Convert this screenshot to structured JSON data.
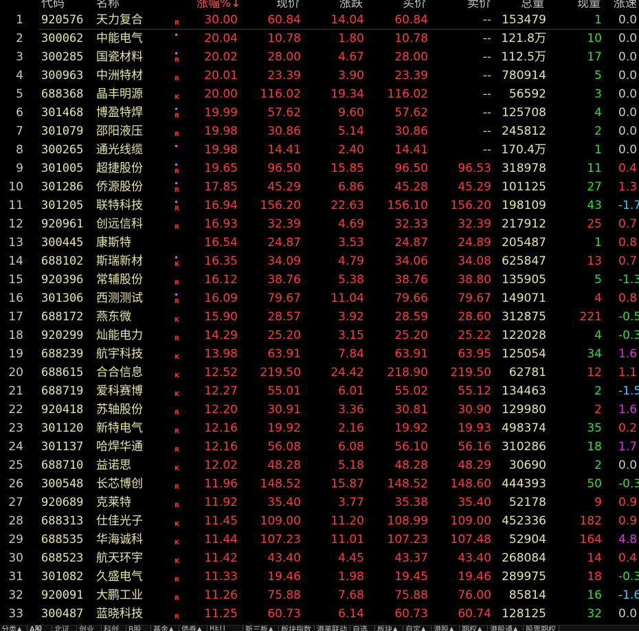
{
  "header": {
    "code": "代码",
    "name": "名称",
    "pct": "涨幅%",
    "sort_arrow": "↓",
    "price": "现价",
    "chg": "涨跌",
    "buy": "买价",
    "sell": "卖价",
    "vol": "总量",
    "cur": "现量",
    "speed": "涨速"
  },
  "colors": {
    "up": "#ff3a3a",
    "down": "#33ccff",
    "green": "#33dd33",
    "purple": "#dd33dd",
    "yellow": "#e6e6a0"
  },
  "rows": [
    {
      "idx": "1",
      "code": "920576",
      "name": "天力复合",
      "dot": false,
      "flag": "R",
      "pct": "30.00",
      "price": "60.84",
      "chg": "14.04",
      "buy": "60.84",
      "sell": "--",
      "vol": "153479",
      "cur": "1",
      "cur_color": "green",
      "speed": "0.0",
      "speed_color": "white"
    },
    {
      "idx": "2",
      "code": "300062",
      "name": "中能电气",
      "dot": true,
      "flag": "",
      "pct": "20.04",
      "price": "10.78",
      "chg": "1.80",
      "buy": "10.78",
      "sell": "--",
      "vol": "121.8万",
      "cur": "10",
      "cur_color": "green",
      "speed": "0.0",
      "speed_color": "white"
    },
    {
      "idx": "3",
      "code": "300285",
      "name": "国瓷材料",
      "dot": true,
      "flag": "R",
      "pct": "20.02",
      "price": "28.00",
      "chg": "4.67",
      "buy": "28.00",
      "sell": "--",
      "vol": "112.5万",
      "cur": "17",
      "cur_color": "green",
      "speed": "0.0",
      "speed_color": "white"
    },
    {
      "idx": "4",
      "code": "300963",
      "name": "中洲特材",
      "dot": false,
      "flag": "R",
      "pct": "20.01",
      "price": "23.39",
      "chg": "3.90",
      "buy": "23.39",
      "sell": "--",
      "vol": "780914",
      "cur": "5",
      "cur_color": "green",
      "speed": "0.0",
      "speed_color": "white"
    },
    {
      "idx": "5",
      "code": "688368",
      "name": "晶丰明源",
      "dot": false,
      "flag": "K",
      "pct": "20.00",
      "price": "116.02",
      "chg": "19.34",
      "buy": "116.02",
      "sell": "--",
      "vol": "56592",
      "cur": "3",
      "cur_color": "green",
      "speed": "0.0",
      "speed_color": "white"
    },
    {
      "idx": "6",
      "code": "301468",
      "name": "博盈特焊",
      "dot": true,
      "flag": "R",
      "pct": "19.99",
      "price": "57.62",
      "chg": "9.60",
      "buy": "57.62",
      "sell": "--",
      "vol": "125708",
      "cur": "4",
      "cur_color": "green",
      "speed": "0.0",
      "speed_color": "white"
    },
    {
      "idx": "7",
      "code": "301079",
      "name": "邵阳液压",
      "dot": false,
      "flag": "R",
      "pct": "19.98",
      "price": "30.86",
      "chg": "5.14",
      "buy": "30.86",
      "sell": "--",
      "vol": "245812",
      "cur": "2",
      "cur_color": "green",
      "speed": "0.0",
      "speed_color": "white"
    },
    {
      "idx": "8",
      "code": "300265",
      "name": "通光线缆",
      "dot": true,
      "flag": "",
      "pct": "19.98",
      "price": "14.41",
      "chg": "2.40",
      "buy": "14.41",
      "sell": "--",
      "vol": "170.4万",
      "cur": "1",
      "cur_color": "green",
      "speed": "0.0",
      "speed_color": "white"
    },
    {
      "idx": "9",
      "code": "301005",
      "name": "超捷股份",
      "dot": true,
      "flag": "R",
      "pct": "19.65",
      "price": "96.50",
      "chg": "15.85",
      "buy": "96.50",
      "sell": "96.53",
      "vol": "318978",
      "cur": "11",
      "cur_color": "green",
      "speed": "0.4",
      "speed_color": "up"
    },
    {
      "idx": "10",
      "code": "301286",
      "name": "侨源股份",
      "dot": true,
      "flag": "R",
      "pct": "17.85",
      "price": "45.29",
      "chg": "6.86",
      "buy": "45.28",
      "sell": "45.29",
      "vol": "101125",
      "cur": "27",
      "cur_color": "green",
      "speed": "1.3",
      "speed_color": "up"
    },
    {
      "idx": "11",
      "code": "301205",
      "name": "联特科技",
      "dot": true,
      "flag": "R",
      "pct": "16.94",
      "price": "156.20",
      "chg": "22.63",
      "buy": "156.10",
      "sell": "156.20",
      "vol": "198109",
      "cur": "43",
      "cur_color": "green",
      "speed": "-1.7",
      "speed_color": "down"
    },
    {
      "idx": "12",
      "code": "920961",
      "name": "创远信科",
      "dot": false,
      "flag": "R",
      "pct": "16.93",
      "price": "32.39",
      "chg": "4.69",
      "buy": "32.33",
      "sell": "32.39",
      "vol": "217912",
      "cur": "25",
      "cur_color": "up",
      "speed": "0.7",
      "speed_color": "up"
    },
    {
      "idx": "13",
      "code": "300445",
      "name": "康斯特",
      "dot": false,
      "flag": "",
      "pct": "16.54",
      "price": "24.87",
      "chg": "3.53",
      "buy": "24.87",
      "sell": "24.89",
      "vol": "205487",
      "cur": "1",
      "cur_color": "green",
      "speed": "0.8",
      "speed_color": "up"
    },
    {
      "idx": "14",
      "code": "688102",
      "name": "斯瑞新材",
      "dot": true,
      "flag": "K",
      "pct": "16.35",
      "price": "34.09",
      "chg": "4.79",
      "buy": "34.06",
      "sell": "34.08",
      "vol": "625847",
      "cur": "13",
      "cur_color": "up",
      "speed": "0.7",
      "speed_color": "up"
    },
    {
      "idx": "15",
      "code": "920396",
      "name": "常辅股份",
      "dot": false,
      "flag": "R",
      "pct": "16.12",
      "price": "38.76",
      "chg": "5.38",
      "buy": "38.76",
      "sell": "38.80",
      "vol": "135905",
      "cur": "5",
      "cur_color": "green",
      "speed": "-1.3",
      "speed_color": "green"
    },
    {
      "idx": "16",
      "code": "301306",
      "name": "西测测试",
      "dot": true,
      "flag": "R",
      "pct": "16.09",
      "price": "79.67",
      "chg": "11.04",
      "buy": "79.66",
      "sell": "79.67",
      "vol": "149071",
      "cur": "4",
      "cur_color": "up",
      "speed": "0.8",
      "speed_color": "up"
    },
    {
      "idx": "17",
      "code": "688172",
      "name": "燕东微",
      "dot": false,
      "flag": "K",
      "pct": "15.90",
      "price": "28.57",
      "chg": "3.92",
      "buy": "28.59",
      "sell": "28.60",
      "vol": "312875",
      "cur": "221",
      "cur_color": "up",
      "speed": "-0.5",
      "speed_color": "green"
    },
    {
      "idx": "18",
      "code": "920299",
      "name": "灿能电力",
      "dot": false,
      "flag": "R",
      "pct": "14.29",
      "price": "25.20",
      "chg": "3.15",
      "buy": "25.20",
      "sell": "25.22",
      "vol": "122028",
      "cur": "4",
      "cur_color": "green",
      "speed": "-0.3",
      "speed_color": "green"
    },
    {
      "idx": "19",
      "code": "688239",
      "name": "航宇科技",
      "dot": false,
      "flag": "K",
      "pct": "13.98",
      "price": "63.91",
      "chg": "7.84",
      "buy": "63.91",
      "sell": "63.95",
      "vol": "125054",
      "cur": "34",
      "cur_color": "green",
      "speed": "1.6",
      "speed_color": "purple"
    },
    {
      "idx": "20",
      "code": "688615",
      "name": "合合信息",
      "dot": false,
      "flag": "K",
      "pct": "12.52",
      "price": "219.50",
      "chg": "24.42",
      "buy": "218.90",
      "sell": "219.50",
      "vol": "62781",
      "cur": "12",
      "cur_color": "up",
      "speed": "1.1",
      "speed_color": "up"
    },
    {
      "idx": "21",
      "code": "688719",
      "name": "爱科赛博",
      "dot": false,
      "flag": "K",
      "pct": "12.27",
      "price": "55.01",
      "chg": "6.01",
      "buy": "55.02",
      "sell": "55.12",
      "vol": "134463",
      "cur": "2",
      "cur_color": "green",
      "speed": "-1.5",
      "speed_color": "down"
    },
    {
      "idx": "22",
      "code": "920418",
      "name": "苏轴股份",
      "dot": false,
      "flag": "R",
      "pct": "12.20",
      "price": "30.91",
      "chg": "3.36",
      "buy": "30.81",
      "sell": "30.90",
      "vol": "129980",
      "cur": "2",
      "cur_color": "up",
      "speed": "1.6",
      "speed_color": "purple"
    },
    {
      "idx": "23",
      "code": "301120",
      "name": "新特电气",
      "dot": false,
      "flag": "R",
      "pct": "12.16",
      "price": "19.92",
      "chg": "2.16",
      "buy": "19.92",
      "sell": "19.93",
      "vol": "498374",
      "cur": "35",
      "cur_color": "green",
      "speed": "0.2",
      "speed_color": "up"
    },
    {
      "idx": "24",
      "code": "301137",
      "name": "哈焊华通",
      "dot": false,
      "flag": "R",
      "pct": "12.16",
      "price": "56.08",
      "chg": "6.08",
      "buy": "56.10",
      "sell": "56.16",
      "vol": "310286",
      "cur": "18",
      "cur_color": "green",
      "speed": "1.7",
      "speed_color": "purple"
    },
    {
      "idx": "25",
      "code": "688710",
      "name": "益诺思",
      "dot": false,
      "flag": "K",
      "pct": "12.02",
      "price": "48.28",
      "chg": "5.18",
      "buy": "48.28",
      "sell": "48.29",
      "vol": "30690",
      "cur": "2",
      "cur_color": "green",
      "speed": "0.0",
      "speed_color": "white"
    },
    {
      "idx": "26",
      "code": "300548",
      "name": "长芯博创",
      "dot": false,
      "flag": "R",
      "pct": "11.96",
      "price": "148.52",
      "chg": "15.87",
      "buy": "148.52",
      "sell": "148.60",
      "vol": "444393",
      "cur": "50",
      "cur_color": "green",
      "speed": "-0.3",
      "speed_color": "green"
    },
    {
      "idx": "27",
      "code": "920689",
      "name": "克莱特",
      "dot": false,
      "flag": "R",
      "pct": "11.92",
      "price": "35.40",
      "chg": "3.77",
      "buy": "35.38",
      "sell": "35.40",
      "vol": "52178",
      "cur": "9",
      "cur_color": "up",
      "speed": "0.9",
      "speed_color": "up"
    },
    {
      "idx": "28",
      "code": "688313",
      "name": "仕佳光子",
      "dot": false,
      "flag": "K",
      "pct": "11.45",
      "price": "109.00",
      "chg": "11.20",
      "buy": "108.99",
      "sell": "109.00",
      "vol": "452336",
      "cur": "182",
      "cur_color": "up",
      "speed": "0.9",
      "speed_color": "up"
    },
    {
      "idx": "29",
      "code": "688535",
      "name": "华海诚科",
      "dot": false,
      "flag": "K",
      "pct": "11.44",
      "price": "107.23",
      "chg": "11.01",
      "buy": "107.23",
      "sell": "107.48",
      "vol": "52904",
      "cur": "164",
      "cur_color": "up",
      "speed": "4.8",
      "speed_color": "purple"
    },
    {
      "idx": "30",
      "code": "688523",
      "name": "航天环宇",
      "dot": false,
      "flag": "K",
      "pct": "11.42",
      "price": "43.40",
      "chg": "4.45",
      "buy": "43.37",
      "sell": "43.40",
      "vol": "268084",
      "cur": "14",
      "cur_color": "up",
      "speed": "0.4",
      "speed_color": "up"
    },
    {
      "idx": "31",
      "code": "301082",
      "name": "久盛电气",
      "dot": false,
      "flag": "R",
      "pct": "11.33",
      "price": "19.46",
      "chg": "1.98",
      "buy": "19.45",
      "sell": "19.46",
      "vol": "289975",
      "cur": "18",
      "cur_color": "up",
      "speed": "-0.3",
      "speed_color": "green"
    },
    {
      "idx": "32",
      "code": "920091",
      "name": "大鹏工业",
      "dot": false,
      "flag": "R",
      "pct": "11.26",
      "price": "75.88",
      "chg": "7.68",
      "buy": "75.88",
      "sell": "76.00",
      "vol": "85814",
      "cur": "16",
      "cur_color": "green",
      "speed": "-1.6",
      "speed_color": "down"
    },
    {
      "idx": "33",
      "code": "300487",
      "name": "蓝晓科技",
      "dot": false,
      "flag": "R",
      "pct": "11.25",
      "price": "60.73",
      "chg": "6.14",
      "buy": "60.73",
      "sell": "60.74",
      "vol": "128125",
      "cur": "32",
      "cur_color": "green",
      "speed": "0.0",
      "speed_color": "white"
    }
  ],
  "tabs": [
    "分类▲",
    "A股",
    "北证",
    "创业",
    "科创",
    "B股",
    "基金▲",
    "债券▲",
    "REIT",
    "新三板▲",
    "板块指数",
    "港美联动",
    "自选",
    "板块▲",
    "自定▲",
    "港股▲",
    "期权▲",
    "港股通▲",
    "股票期权"
  ]
}
